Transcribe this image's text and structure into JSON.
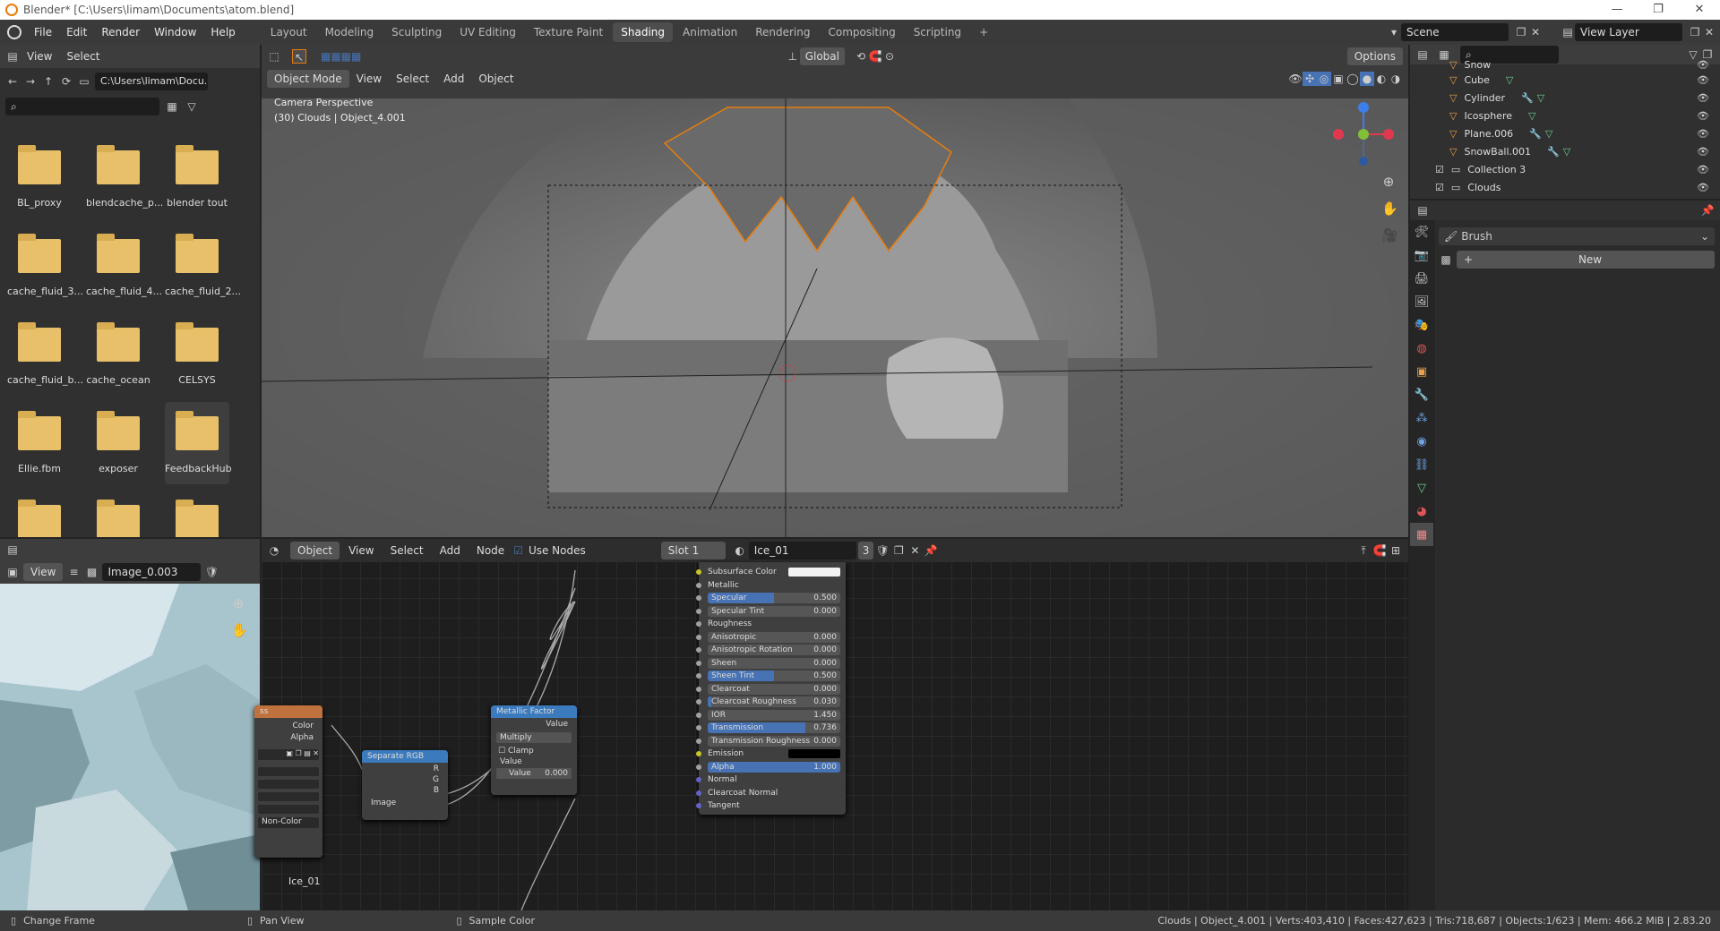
{
  "titlebar": {
    "title": "Blender* [C:\\Users\\limam\\Documents\\atom.blend]"
  },
  "topbar": {
    "menus": [
      "File",
      "Edit",
      "Render",
      "Window",
      "Help"
    ],
    "workspaces": [
      "Layout",
      "Modeling",
      "Sculpting",
      "UV Editing",
      "Texture Paint",
      "Shading",
      "Animation",
      "Rendering",
      "Compositing",
      "Scripting"
    ],
    "active_workspace": "Shading",
    "add_tab": "+",
    "scene": "Scene",
    "view_layer": "View Layer"
  },
  "filebrowser": {
    "menus": [
      "View",
      "Select"
    ],
    "path": "C:\\Users\\limam\\Docu...",
    "folders": [
      "BL_proxy",
      "blendcache_p...",
      "blender tout",
      "cache_fluid_3...",
      "cache_fluid_4...",
      "cache_fluid_2...",
      "cache_fluid_b...",
      "cache_ocean",
      "CELSYS",
      "Ellie.fbm",
      "exposer",
      "FeedbackHub",
      "",
      "",
      ""
    ]
  },
  "viewport": {
    "mode": "Object Mode",
    "menus": [
      "View",
      "Select",
      "Add",
      "Object"
    ],
    "orientation": "Global",
    "options": "Options",
    "overlay_line1": "Camera Perspective",
    "overlay_line2": "(30) Clouds | Object_4.001"
  },
  "outliner": {
    "items": [
      {
        "name": "Snow",
        "type": "obj"
      },
      {
        "name": "Cube",
        "type": "obj"
      },
      {
        "name": "Cylinder",
        "type": "obj"
      },
      {
        "name": "Icosphere",
        "type": "obj"
      },
      {
        "name": "Plane.006",
        "type": "obj"
      },
      {
        "name": "SnowBall.001",
        "type": "obj"
      },
      {
        "name": "Collection 3",
        "type": "col"
      },
      {
        "name": "Clouds",
        "type": "col"
      }
    ]
  },
  "properties": {
    "brush_label": "Brush",
    "new_button": "New"
  },
  "image_editor": {
    "menu": "View",
    "image_name": "Image_0.003"
  },
  "node_editor": {
    "object_type": "Object",
    "menus": [
      "View",
      "Select",
      "Add",
      "Node"
    ],
    "use_nodes": "Use Nodes",
    "slot": "Slot 1",
    "material": "Ice_01",
    "users": "3",
    "material_label": "Ice_01",
    "image_node": {
      "title": "ss",
      "out_color": "Color",
      "out_alpha": "Alpha",
      "colorspace": "Non-Color"
    },
    "separate_node": {
      "title": "Separate RGB",
      "r": "R",
      "g": "G",
      "b": "B",
      "image": "Image"
    },
    "math_node": {
      "title": "Metallic Factor",
      "out": "Value",
      "op": "Multiply",
      "clamp": "Clamp",
      "value_label": "Value",
      "value_field": "Value",
      "value_num": "0.000"
    },
    "bsdf_rows": [
      {
        "label": "Subsurface Color",
        "kind": "color",
        "color": "#f2f2f2"
      },
      {
        "label": "Metallic",
        "kind": "text"
      },
      {
        "label": "Specular",
        "kind": "slider",
        "value": "0.500",
        "fill": 0.5
      },
      {
        "label": "Specular Tint",
        "kind": "slider",
        "value": "0.000",
        "fill": 0
      },
      {
        "label": "Roughness",
        "kind": "text"
      },
      {
        "label": "Anisotropic",
        "kind": "slider",
        "value": "0.000",
        "fill": 0
      },
      {
        "label": "Anisotropic Rotation",
        "kind": "slider",
        "value": "0.000",
        "fill": 0
      },
      {
        "label": "Sheen",
        "kind": "slider",
        "value": "0.000",
        "fill": 0
      },
      {
        "label": "Sheen Tint",
        "kind": "slider",
        "value": "0.500",
        "fill": 0.5
      },
      {
        "label": "Clearcoat",
        "kind": "slider",
        "value": "0.000",
        "fill": 0
      },
      {
        "label": "Clearcoat Roughness",
        "kind": "slider",
        "value": "0.030",
        "fill": 0.03
      },
      {
        "label": "IOR",
        "kind": "slider",
        "value": "1.450",
        "fill": 0
      },
      {
        "label": "Transmission",
        "kind": "slider",
        "value": "0.736",
        "fill": 0.736
      },
      {
        "label": "Transmission Roughness",
        "kind": "slider",
        "value": "0.000",
        "fill": 0
      },
      {
        "label": "Emission",
        "kind": "color",
        "color": "#000000"
      },
      {
        "label": "Alpha",
        "kind": "slider",
        "value": "1.000",
        "fill": 1
      },
      {
        "label": "Normal",
        "kind": "text"
      },
      {
        "label": "Clearcoat Normal",
        "kind": "text"
      },
      {
        "label": "Tangent",
        "kind": "text"
      }
    ]
  },
  "status": {
    "left1": "Change Frame",
    "left2": "Pan View",
    "left3": "Sample Color",
    "right": "Clouds | Object_4.001 | Verts:403,410 | Faces:427,623 | Tris:718,687 | Objects:1/623 | Mem: 466.2 MiB | 2.83.20"
  },
  "colors": {
    "accent": "#4772b3",
    "active_orange": "#e87d0d"
  }
}
